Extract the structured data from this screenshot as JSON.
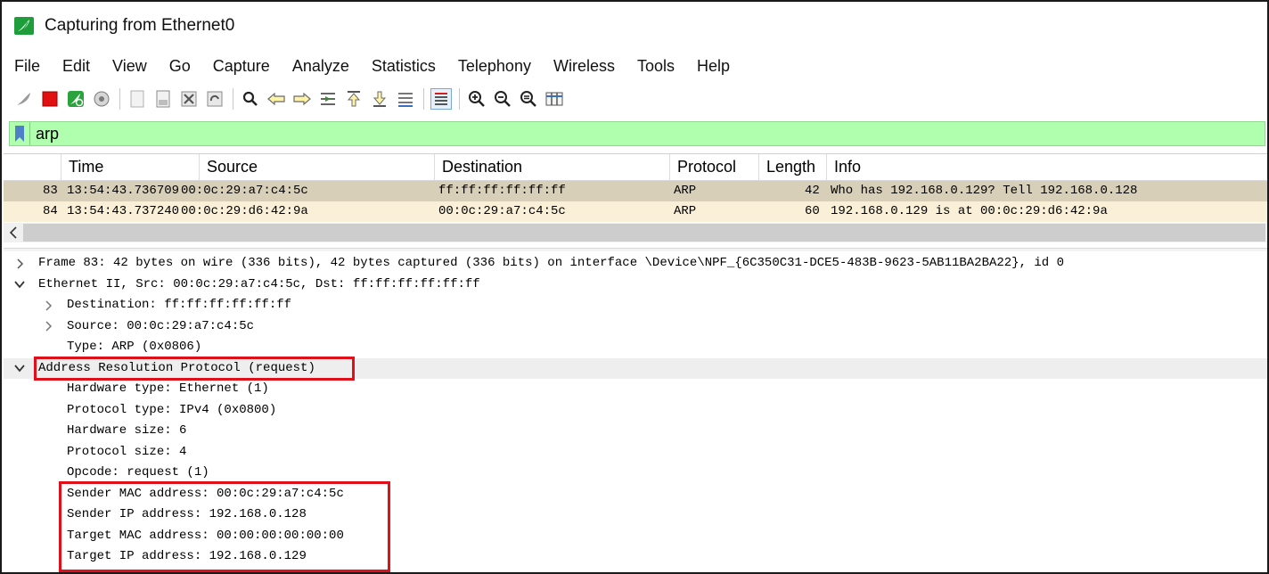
{
  "window": {
    "title": "Capturing from Ethernet0"
  },
  "menu": [
    "File",
    "Edit",
    "View",
    "Go",
    "Capture",
    "Analyze",
    "Statistics",
    "Telephony",
    "Wireless",
    "Tools",
    "Help"
  ],
  "toolbar": {
    "icons": [
      "shark-fin-start-icon",
      "stop-capture-icon",
      "restart-capture-icon",
      "capture-options-icon",
      "open-file-icon",
      "save-file-icon",
      "close-file-icon",
      "reload-file-icon",
      "find-packet-icon",
      "go-back-icon",
      "go-forward-icon",
      "go-to-packet-icon",
      "first-packet-icon",
      "last-packet-icon",
      "auto-scroll-icon",
      "colorize-icon",
      "zoom-in-icon",
      "zoom-out-icon",
      "normal-size-icon",
      "resize-columns-icon"
    ]
  },
  "filter": {
    "value": "arp"
  },
  "packet_list": {
    "columns": [
      "Time",
      "Source",
      "Destination",
      "Protocol",
      "Length",
      "Info"
    ],
    "rows": [
      {
        "no": "83",
        "time": "13:54:43.736709",
        "source": "00:0c:29:a7:c4:5c",
        "destination": "ff:ff:ff:ff:ff:ff",
        "protocol": "ARP",
        "length": "42",
        "info": "Who has 192.168.0.129? Tell 192.168.0.128"
      },
      {
        "no": "84",
        "time": "13:54:43.737240",
        "source": "00:0c:29:d6:42:9a",
        "destination": "00:0c:29:a7:c4:5c",
        "protocol": "ARP",
        "length": "60",
        "info": "192.168.0.129 is at 00:0c:29:d6:42:9a"
      }
    ]
  },
  "details": {
    "frame": "Frame 83: 42 bytes on wire (336 bits), 42 bytes captured (336 bits) on interface \\Device\\NPF_{6C350C31-DCE5-483B-9623-5AB11BA2BA22}, id 0",
    "ethernet": "Ethernet II, Src: 00:0c:29:a7:c4:5c, Dst: ff:ff:ff:ff:ff:ff",
    "eth_destination": "Destination: ff:ff:ff:ff:ff:ff",
    "eth_source": "Source: 00:0c:29:a7:c4:5c",
    "eth_type": "Type: ARP (0x0806)",
    "arp": "Address Resolution Protocol (request)",
    "hw_type": "Hardware type: Ethernet (1)",
    "proto_type": "Protocol type: IPv4 (0x0800)",
    "hw_size": "Hardware size: 6",
    "proto_size": "Protocol size: 4",
    "opcode": "Opcode: request (1)",
    "sender_mac": "Sender MAC address: 00:0c:29:a7:c4:5c",
    "sender_ip": "Sender IP address: 192.168.0.128",
    "target_mac": "Target MAC address: 00:00:00:00:00:00",
    "target_ip": "Target IP address: 192.168.0.129"
  },
  "colors": {
    "filter_bg": "#afffaf",
    "selected_row": "#d8cfb8",
    "arp_row": "#faf0d7",
    "highlight": "#e0101a"
  }
}
